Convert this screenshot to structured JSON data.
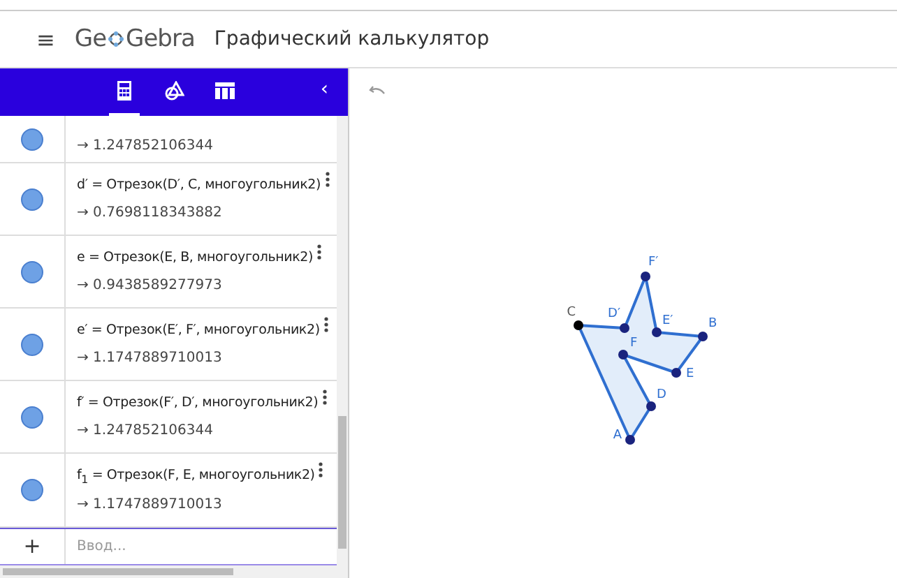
{
  "header": {
    "menu_icon": "≡",
    "logo_start": "Ge",
    "logo_end": "Gebra",
    "app_name": "Графический калькулятор",
    "collapse_icon": "‹"
  },
  "algebra_tabs": [
    {
      "kind": "calculator",
      "selected": true
    },
    {
      "kind": "tools",
      "selected": false
    },
    {
      "kind": "table",
      "selected": false
    }
  ],
  "algebra_items": [
    {
      "value": "→ 1.247852106344"
    },
    {
      "definition": "d′ = Отрезок(D′, C, многоугольник2)",
      "value": "→ 0.7698118343882"
    },
    {
      "definition": "e = Отрезок(E, B, многоугольник2)",
      "value": "→ 0.9438589277973"
    },
    {
      "definition": "e′ = Отрезок(E′, F′, многоугольник2)",
      "value": "→ 1.1747889710013"
    },
    {
      "definition": "f′ = Отрезок(F′, D′, многоугольник2)",
      "value": "→ 1.247852106344"
    },
    {
      "definition": "f$_{1}$ = Отрезок(F, E, многоугольник2)",
      "value": "→ 1.1747889710013"
    }
  ],
  "input": {
    "add_symbol": "+",
    "placeholder": "Ввод..."
  },
  "points": [
    {
      "label": "C",
      "color": "#000000"
    },
    {
      "label": "D′",
      "color": "#1a237e"
    },
    {
      "label": "F′",
      "color": "#1a237e"
    },
    {
      "label": "E′",
      "color": "#1a237e"
    },
    {
      "label": "B",
      "color": "#1a237e"
    },
    {
      "label": "E",
      "color": "#1a237e"
    },
    {
      "label": "F",
      "color": "#1a237e"
    },
    {
      "label": "D",
      "color": "#1a237e"
    },
    {
      "label": "A",
      "color": "#1a237e"
    }
  ]
}
